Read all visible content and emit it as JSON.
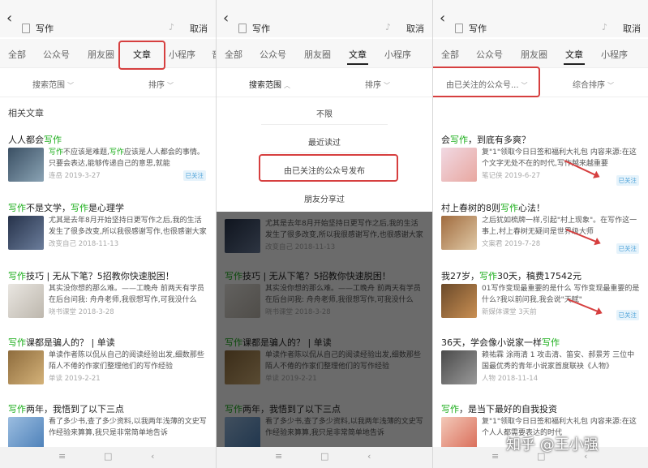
{
  "search": {
    "query": "写作",
    "cancel_label": "取消"
  },
  "tabs": [
    "全部",
    "公众号",
    "朋友圈",
    "文章",
    "小程序",
    "音"
  ],
  "panel1": {
    "filter_scope": "搜索范围",
    "filter_sort": "排序",
    "section_title": "相关文章",
    "articles": [
      {
        "title_pre": "人人都会",
        "title_hl": "写作",
        "title_post": "",
        "snippet_a": "写作",
        "snippet_b": "不应该是难题,",
        "snippet_c": "写作",
        "snippet_d": "应该是人人都会的事情。只要会表达,能够传递自己的意思,就能",
        "meta": "连岳 2019-3-27",
        "badge": "已关注"
      },
      {
        "title_pre": "",
        "title_hl": "写作",
        "title_post": "不是文学，",
        "title_hl2": "写作",
        "title_post2": "是心理学",
        "snippet": "尤其是去年8月开始坚持日更写作之后,我的生活发生了很多改变,所以我很感谢写作,也很感谢大家",
        "meta": "改变自己 2018-11-13"
      },
      {
        "title_pre": "",
        "title_hl": "写作",
        "title_post": "技巧 | 无从下笔？5招教你快速脱困！",
        "snippet": "其实没你想的那么难。——工晚舟 前两天有学员在后台问我: 舟舟老师,我很想写作,可我没什么",
        "meta": "晓书课堂 2018-3-28"
      },
      {
        "title_pre": "",
        "title_hl": "写作",
        "title_post": "课都是骗人的？ | 单读",
        "snippet": "单读作者陈以侃从自己的阅读经验出发,细数那些陌人不倦的作家们整理他们的写作经验",
        "meta": "单读 2019-2-21"
      },
      {
        "title_pre": "",
        "title_hl": "写作",
        "title_post": "两年，我悟到了以下三点",
        "snippet": "看了多少书,查了多少资料,以我两年浅薄的文史写作经验来算算,我只是非常简单地告诉",
        "meta": ""
      }
    ]
  },
  "panel2": {
    "filter_scope": "搜索范围",
    "filter_sort": "排序",
    "scope_options": [
      "不限",
      "最近读过",
      "由已关注的公众号发布",
      "朋友分享过"
    ]
  },
  "panel3": {
    "filter_scope": "由已关注的公众号...",
    "filter_sort": "综合排序",
    "articles": [
      {
        "title_pre": "会",
        "title_hl": "写作",
        "title_post": "，到底有多爽？",
        "snippet": "复\"1\"领取今日日签和福利大礼包 内容来源:在这个文字无处不在的时代,写作越来越重要",
        "meta": "笔记侠 2019-6-27",
        "badge": "已关注"
      },
      {
        "title_pre": "村上春树的8则",
        "title_hl": "写作",
        "title_post": "心法！",
        "snippet": "之后犹如梳牌一样,引起\"村上现象\"。在写作这一事上,村上春树无疑问是世界级大师",
        "meta": "文案君 2019-7-28",
        "badge": "已关注"
      },
      {
        "title_pre": "我27岁，",
        "title_hl": "写作",
        "title_post": "30天，稿费17542元",
        "snippet": "01写作变现最重要的是什么 写作变现最重要的是什么?我以前问我,我会说\"天赋\"",
        "meta": "新媒体课堂 3天前",
        "badge": "已关注"
      },
      {
        "title_pre": "36天，学会像小说家一样",
        "title_hl": "写作",
        "title_post": "",
        "snippet": "赖祐霖 涂雨清 1 攻击清、笛安、郝景芳 三位中国最优秀的青年小说家首度联袂《人物》",
        "meta": "人物 2018-11-14"
      },
      {
        "title_pre": "",
        "title_hl": "写作",
        "title_post": "，是当下最好的自我投资",
        "snippet": "复\"1\"领取今日日签和福利大礼包 内容来源:在这个人人都需要表达的时代",
        "meta": ""
      }
    ]
  },
  "watermark": "知乎 @王小强"
}
